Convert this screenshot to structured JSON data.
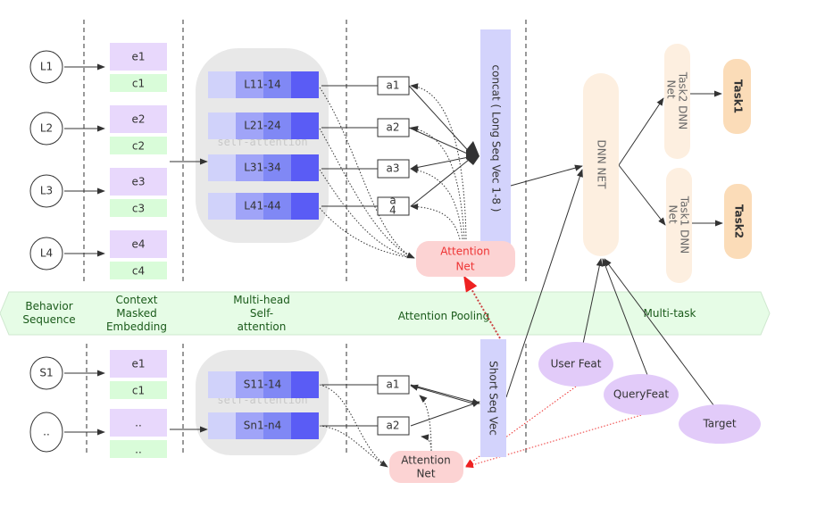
{
  "banner": {
    "behavior": [
      "Behavior",
      "Sequence"
    ],
    "embedding": [
      "Context",
      "Masked",
      "Embedding"
    ],
    "multihead": [
      "Multi-head",
      "Self-",
      "attention"
    ],
    "pooling": "Attention Pooling",
    "multitask": "Multi-task"
  },
  "long": {
    "inputs": [
      "L1",
      "L2",
      "L3",
      "L4"
    ],
    "embeds": [
      "e1",
      "e2",
      "e3",
      "e4"
    ],
    "contexts": [
      "c1",
      "c2",
      "c3",
      "c4"
    ],
    "heads": [
      "L11-14",
      "L21-24",
      "L31-34",
      "L41-44"
    ],
    "self_attention": "self-attention",
    "weights": [
      "a1",
      "a2",
      "a3"
    ],
    "weight4": [
      "a",
      "4"
    ],
    "concat": "concat ( Long Seq Vec 1-8 )",
    "attention_net": [
      "Attention",
      "Net"
    ]
  },
  "short": {
    "inputs": [
      "S1",
      ".."
    ],
    "embeds": [
      "e1",
      ".."
    ],
    "contexts": [
      "c1",
      ".."
    ],
    "heads": [
      "S11-14",
      "Sn1-n4"
    ],
    "self_attention": "self-attention",
    "weights": [
      "a1",
      "a2"
    ],
    "vec": "Short Seq Vec",
    "attention_net": [
      "Attention",
      "Net"
    ]
  },
  "features": [
    "User Feat",
    "QueryFeat",
    "Target"
  ],
  "dnn": "DNN NET",
  "task_nets": [
    [
      "Task2 DNN",
      "Net"
    ],
    [
      "Task1 DNN",
      "Net"
    ]
  ],
  "tasks": [
    "Task1",
    "Task2"
  ],
  "colors": {
    "embed": "#e8d8fc",
    "context": "#d9fcd9",
    "head_segments": [
      "#d0d2fa",
      "#a0a4f8",
      "#8088f5",
      "#5a5cf5"
    ],
    "concat": "#d3d3fc",
    "attention_net": "#fcd3d3",
    "dnn": "#fdefe0",
    "task": "#fbdcb8",
    "feature": "#e2cbf9",
    "banner": "#e6fce6"
  }
}
